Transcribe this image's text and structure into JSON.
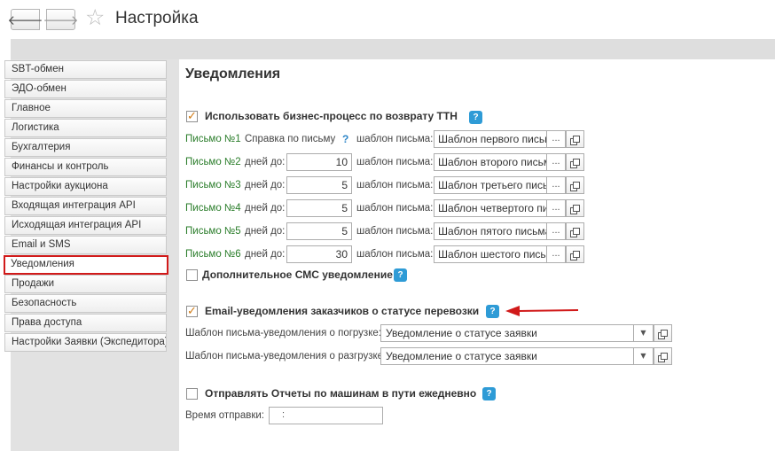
{
  "window": {
    "title": "Настройка"
  },
  "nav": {
    "back": "🡐",
    "forward": "🡒",
    "favorite": "☆"
  },
  "sidebar": {
    "items": [
      {
        "label": "SBT-обмен"
      },
      {
        "label": "ЭДО-обмен"
      },
      {
        "label": "Главное"
      },
      {
        "label": "Логистика"
      },
      {
        "label": "Бухгалтерия"
      },
      {
        "label": "Финансы и контроль"
      },
      {
        "label": "Настройки аукциона"
      },
      {
        "label": "Входящая интеграция API"
      },
      {
        "label": "Исходящая интеграция API"
      },
      {
        "label": "Email и SMS"
      },
      {
        "label": "Уведомления",
        "active": true
      },
      {
        "label": "Продажи"
      },
      {
        "label": "Безопасность"
      },
      {
        "label": "Права доступа"
      },
      {
        "label": "Настройки Заявки (Экспедитора)"
      }
    ]
  },
  "main": {
    "title": "Уведомления",
    "help_glyph": "?",
    "check_glyph": "✓",
    "use_bp": {
      "label": "Использовать бизнес-процесс по возврату ТТН",
      "checked": true
    },
    "letters": [
      {
        "name": "Письмо №1",
        "param_label": "Справка по письму",
        "help": "?",
        "tpl_label": "шаблон письма:",
        "template": "Шаблон первого письма",
        "dots": "..."
      },
      {
        "name": "Письмо №2",
        "param_label": "дней до:",
        "days": "10",
        "tpl_label": "шаблон письма:",
        "template": "Шаблон второго письма",
        "dots": "..."
      },
      {
        "name": "Письмо №3",
        "param_label": "дней до:",
        "days": "5",
        "tpl_label": "шаблон письма:",
        "template": "Шаблон третьего письма",
        "dots": "..."
      },
      {
        "name": "Письмо №4",
        "param_label": "дней до:",
        "days": "5",
        "tpl_label": "шаблон письма:",
        "template": "Шаблон четвертого письма",
        "dots": "..."
      },
      {
        "name": "Письмо №5",
        "param_label": "дней до:",
        "days": "5",
        "tpl_label": "шаблон письма:",
        "template": "Шаблон пятого письма",
        "dots": "..."
      },
      {
        "name": "Письмо №6",
        "param_label": "дней до:",
        "days": "30",
        "tpl_label": "шаблон письма:",
        "template": "Шаблон шестого письма",
        "dots": "..."
      }
    ],
    "extra_sms": {
      "label": "Дополнительное СМС уведомление",
      "checked": false
    },
    "email_notify": {
      "label": "Email-уведомления заказчиков о статусе перевозки",
      "checked": true
    },
    "load_template": {
      "label": "Шаблон письма-уведомления о погрузке:",
      "value": "Уведомление о статусе заявки",
      "arrow": "▼"
    },
    "unload_template": {
      "label": "Шаблон письма-уведомления о разгрузке:",
      "value": "Уведомление о статусе заявки",
      "arrow": "▼"
    },
    "daily_reports": {
      "label": "Отправлять Отчеты по машинам в пути ежедневно",
      "checked": false
    },
    "send_time": {
      "label": "Время отправки:",
      "value": ":"
    }
  },
  "colors": {
    "accent_red": "#d11a1a",
    "help_blue": "#2e9bd6",
    "green_label": "#2a7d2a",
    "checkbox_mark": "#d07a14"
  }
}
